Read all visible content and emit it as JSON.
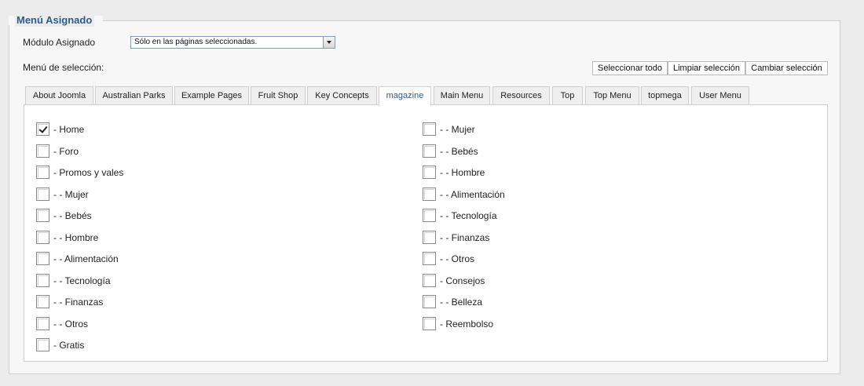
{
  "fieldset": {
    "legend": "Menú Asignado"
  },
  "module": {
    "label": "Módulo Asignado",
    "selected": "Sólo en las páginas seleccionadas."
  },
  "selection": {
    "label": "Menú de selección:",
    "buttons": [
      "Seleccionar todo",
      "Limpiar selección",
      "Cambiar selección"
    ]
  },
  "tabs": [
    {
      "label": "About Joomla",
      "active": false
    },
    {
      "label": "Australian Parks",
      "active": false
    },
    {
      "label": "Example Pages",
      "active": false
    },
    {
      "label": "Fruit Shop",
      "active": false
    },
    {
      "label": "Key Concepts",
      "active": false
    },
    {
      "label": "magazine",
      "active": true
    },
    {
      "label": "Main Menu",
      "active": false
    },
    {
      "label": "Resources",
      "active": false
    },
    {
      "label": "Top",
      "active": false
    },
    {
      "label": "Top Menu",
      "active": false
    },
    {
      "label": "topmega",
      "active": false
    },
    {
      "label": "User Menu",
      "active": false
    }
  ],
  "items_left": [
    {
      "label": "- Home",
      "checked": true
    },
    {
      "label": "- Foro",
      "checked": false
    },
    {
      "label": "- Promos y vales",
      "checked": false
    },
    {
      "label": "- - Mujer",
      "checked": false
    },
    {
      "label": "- - Bebés",
      "checked": false
    },
    {
      "label": "- - Hombre",
      "checked": false
    },
    {
      "label": "- - Alimentación",
      "checked": false
    },
    {
      "label": "- - Tecnología",
      "checked": false
    },
    {
      "label": "- - Finanzas",
      "checked": false
    },
    {
      "label": "- - Otros",
      "checked": false
    },
    {
      "label": "- Gratis",
      "checked": false
    }
  ],
  "items_right": [
    {
      "label": "- - Mujer",
      "checked": false
    },
    {
      "label": "- - Bebés",
      "checked": false
    },
    {
      "label": "- - Hombre",
      "checked": false
    },
    {
      "label": "- - Alimentación",
      "checked": false
    },
    {
      "label": "- - Tecnología",
      "checked": false
    },
    {
      "label": "- - Finanzas",
      "checked": false
    },
    {
      "label": "- - Otros",
      "checked": false
    },
    {
      "label": "- Consejos",
      "checked": false
    },
    {
      "label": "- - Belleza",
      "checked": false
    },
    {
      "label": "- Reembolso",
      "checked": false
    }
  ],
  "colors": {
    "legend": "#2c5d8c",
    "active_tab_text": "#2c5d8c",
    "page_bg": "#ececec"
  }
}
